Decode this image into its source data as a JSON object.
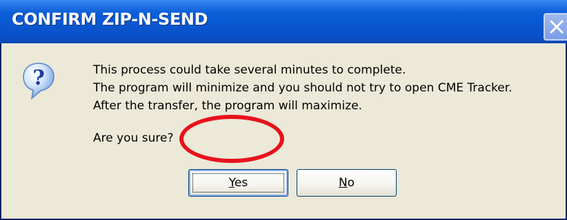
{
  "dialog": {
    "title": "CONFIRM ZIP-N-SEND",
    "icon": "question-icon",
    "message_lines": [
      "This process could take several minutes to complete.",
      "The program will minimize and you should not try to open CME Tracker.",
      "After the transfer, the program will maximize."
    ],
    "question": "Are you sure?",
    "buttons": {
      "yes": {
        "mnemonic": "Y",
        "rest": "es"
      },
      "no": {
        "mnemonic": "N",
        "rest": "o"
      }
    }
  },
  "colors": {
    "titlebar": "#0a56cf",
    "dialog_background": "#ece9d8",
    "annotation_ring": "#e8121c"
  }
}
